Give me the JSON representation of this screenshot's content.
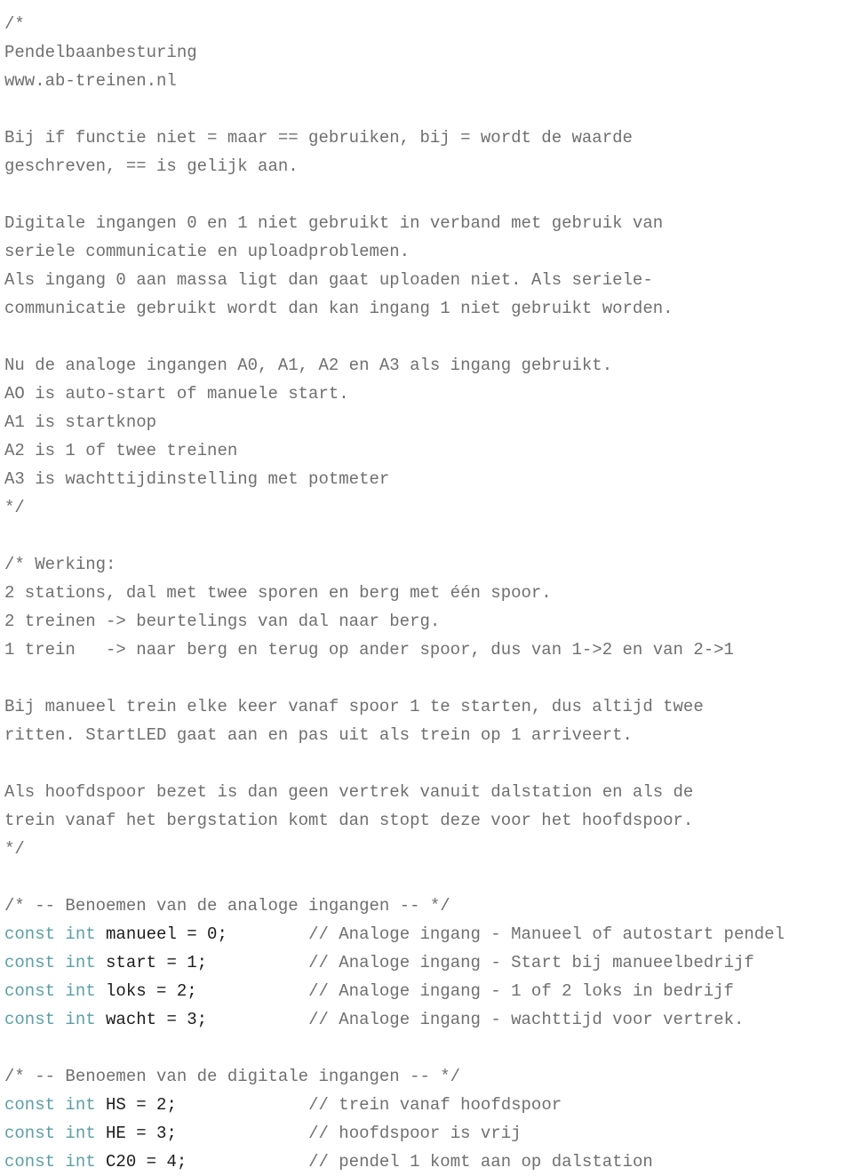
{
  "document": {
    "kind": "source-code-listing",
    "language": "arduino-c",
    "title": "Pendelbaanbesturing",
    "website": "www.ab-treinen.nl",
    "colors": {
      "background": "#ffffff",
      "comment": "#6f6f6f",
      "keyword": "#5e9ea4",
      "identifier": "#1c1c1c"
    }
  },
  "lines": [
    {
      "type": "comment",
      "text": "/*"
    },
    {
      "type": "comment",
      "text": "Pendelbaanbesturing"
    },
    {
      "type": "comment",
      "text": "www.ab-treinen.nl"
    },
    {
      "type": "blank",
      "text": ""
    },
    {
      "type": "comment",
      "text": "Bij if functie niet = maar == gebruiken, bij = wordt de waarde"
    },
    {
      "type": "comment",
      "text": "geschreven, == is gelijk aan."
    },
    {
      "type": "blank",
      "text": ""
    },
    {
      "type": "comment",
      "text": "Digitale ingangen 0 en 1 niet gebruikt in verband met gebruik van"
    },
    {
      "type": "comment",
      "text": "seriele communicatie en uploadproblemen."
    },
    {
      "type": "comment",
      "text": "Als ingang 0 aan massa ligt dan gaat uploaden niet. Als seriele-"
    },
    {
      "type": "comment",
      "text": "communicatie gebruikt wordt dan kan ingang 1 niet gebruikt worden."
    },
    {
      "type": "blank",
      "text": ""
    },
    {
      "type": "comment",
      "text": "Nu de analoge ingangen A0, A1, A2 en A3 als ingang gebruikt."
    },
    {
      "type": "comment",
      "text": "AO is auto-start of manuele start."
    },
    {
      "type": "comment",
      "text": "A1 is startknop"
    },
    {
      "type": "comment",
      "text": "A2 is 1 of twee treinen"
    },
    {
      "type": "comment",
      "text": "A3 is wachttijdinstelling met potmeter"
    },
    {
      "type": "comment",
      "text": "*/"
    },
    {
      "type": "blank",
      "text": ""
    },
    {
      "type": "comment",
      "text": "/* Werking:"
    },
    {
      "type": "comment",
      "text": "2 stations, dal met twee sporen en berg met één spoor."
    },
    {
      "type": "comment",
      "text": "2 treinen -> beurtelings van dal naar berg."
    },
    {
      "type": "comment",
      "text": "1 trein   -> naar berg en terug op ander spoor, dus van 1->2 en van 2->1"
    },
    {
      "type": "blank",
      "text": ""
    },
    {
      "type": "comment",
      "text": "Bij manueel trein elke keer vanaf spoor 1 te starten, dus altijd twee"
    },
    {
      "type": "comment",
      "text": "ritten. StartLED gaat aan en pas uit als trein op 1 arriveert."
    },
    {
      "type": "blank",
      "text": ""
    },
    {
      "type": "comment",
      "text": "Als hoofdspoor bezet is dan geen vertrek vanuit dalstation en als de"
    },
    {
      "type": "comment",
      "text": "trein vanaf het bergstation komt dan stopt deze voor het hoofdspoor."
    },
    {
      "type": "comment",
      "text": "*/"
    },
    {
      "type": "blank",
      "text": ""
    },
    {
      "type": "comment",
      "text": "/* -- Benoemen van de analoge ingangen -- */"
    },
    {
      "type": "decl",
      "keyword": "const int ",
      "decl": "manueel = 0;",
      "pad": "        ",
      "comment": "// Analoge ingang - Manueel of autostart pendel"
    },
    {
      "type": "decl",
      "keyword": "const int ",
      "decl": "start = 1;",
      "pad": "          ",
      "comment": "// Analoge ingang - Start bij manueelbedrijf"
    },
    {
      "type": "decl",
      "keyword": "const int ",
      "decl": "loks = 2;",
      "pad": "           ",
      "comment": "// Analoge ingang - 1 of 2 loks in bedrijf"
    },
    {
      "type": "decl",
      "keyword": "const int ",
      "decl": "wacht = 3;",
      "pad": "          ",
      "comment": "// Analoge ingang - wachttijd voor vertrek."
    },
    {
      "type": "blank",
      "text": ""
    },
    {
      "type": "comment",
      "text": "/* -- Benoemen van de digitale ingangen -- */"
    },
    {
      "type": "decl",
      "keyword": "const int ",
      "decl": "HS = 2;",
      "pad": "             ",
      "comment": "// trein vanaf hoofdspoor"
    },
    {
      "type": "decl",
      "keyword": "const int ",
      "decl": "HE = 3;",
      "pad": "             ",
      "comment": "// hoofdspoor is vrij"
    },
    {
      "type": "decl",
      "keyword": "const int ",
      "decl": "C20 = 4;",
      "pad": "            ",
      "comment": "// pendel 1 komt aan op dalstation"
    }
  ]
}
